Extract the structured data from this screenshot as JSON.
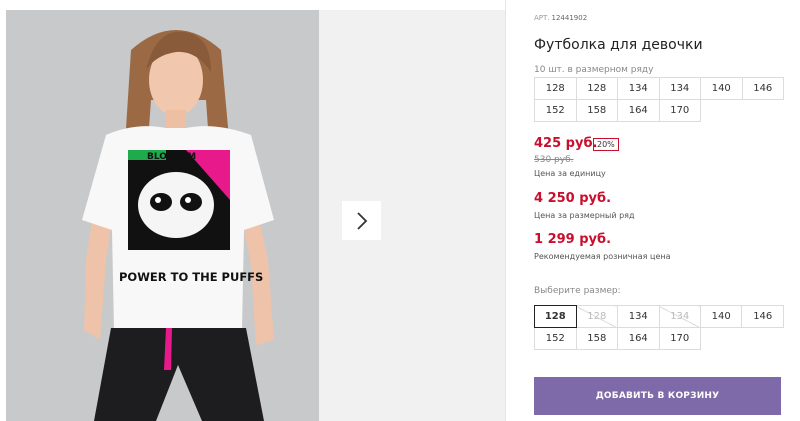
{
  "product": {
    "sku_label": "АРТ.",
    "sku": "12441902",
    "title": "Футболка для девочки",
    "pack_note": "10 шт. в размерном ряду",
    "pack_sizes": [
      "128",
      "128",
      "134",
      "134",
      "140",
      "146",
      "152",
      "158",
      "164",
      "170"
    ],
    "tshirt_print": "POWER TO THE PUFFS",
    "tshirt_brand": "BLOSSOM"
  },
  "pricing": {
    "unit_price": "425 руб.",
    "discount_badge": "20%",
    "old_price": "530 руб.",
    "unit_caption": "Цена за единицу",
    "pack_price": "4 250 руб.",
    "pack_caption": "Цена за размерный ряд",
    "retail_price": "1 299 руб.",
    "retail_caption": "Рекомендуемая розничная цена"
  },
  "size_select": {
    "label": "Выберите размер:",
    "options": [
      {
        "label": "128",
        "state": "selected"
      },
      {
        "label": "128",
        "state": "unavailable"
      },
      {
        "label": "134",
        "state": "available"
      },
      {
        "label": "134",
        "state": "unavailable"
      },
      {
        "label": "140",
        "state": "available"
      },
      {
        "label": "146",
        "state": "available"
      },
      {
        "label": "152",
        "state": "available"
      },
      {
        "label": "158",
        "state": "available"
      },
      {
        "label": "164",
        "state": "available"
      },
      {
        "label": "170",
        "state": "available"
      }
    ]
  },
  "actions": {
    "add_to_cart": "ДОБАВИТЬ В КОРЗИНУ"
  },
  "icons": {
    "gallery_next": "chevron-right-icon"
  },
  "colors": {
    "price_red": "#c8102e",
    "cart_button": "#7e6aa8",
    "tshirt_pink": "#e8198b",
    "tshirt_green": "#1faa4b"
  }
}
